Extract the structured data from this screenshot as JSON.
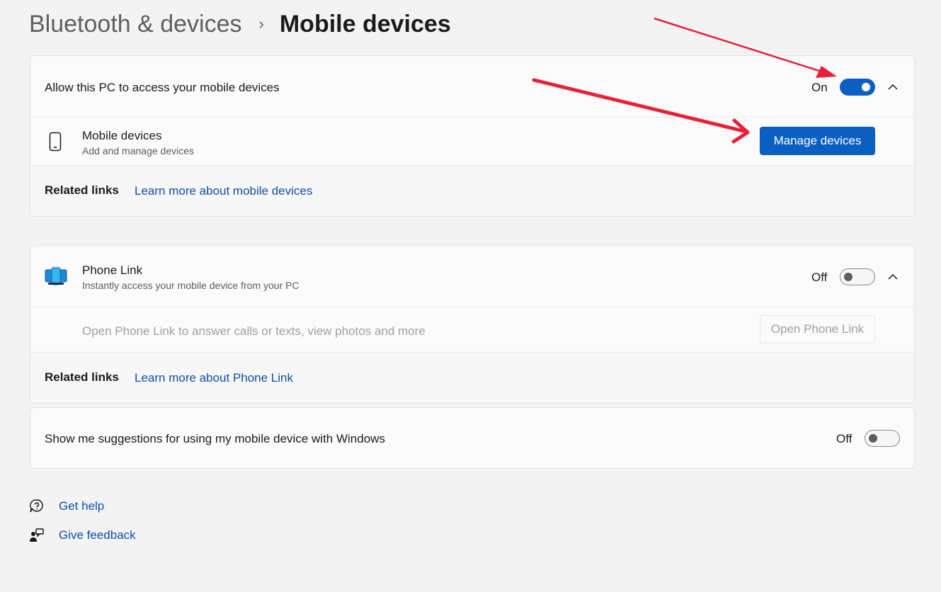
{
  "breadcrumb": {
    "parent": "Bluetooth & devices",
    "separator": "›",
    "current": "Mobile devices"
  },
  "mobile_access": {
    "label": "Allow this PC to access your mobile devices",
    "state_label": "On",
    "enabled": true,
    "device_row": {
      "icon": "phone-icon",
      "title": "Mobile devices",
      "subtitle": "Add and manage devices",
      "button_label": "Manage devices"
    },
    "related": {
      "label": "Related links",
      "link": "Learn more about mobile devices"
    }
  },
  "phone_link": {
    "icon": "phone-link-app-icon",
    "title": "Phone Link",
    "subtitle": "Instantly access your mobile device from your PC",
    "state_label": "Off",
    "enabled": false,
    "open_row": {
      "description": "Open Phone Link to answer calls or texts, view photos and more",
      "button_label": "Open Phone Link"
    },
    "related": {
      "label": "Related links",
      "link": "Learn more about Phone Link"
    }
  },
  "suggestions": {
    "label": "Show me suggestions for using my mobile device with Windows",
    "state_label": "Off",
    "enabled": false
  },
  "footer": {
    "help": {
      "icon": "help-icon",
      "label": "Get help"
    },
    "feedback": {
      "icon": "feedback-icon",
      "label": "Give feedback"
    }
  },
  "colors": {
    "accent": "#0b5fc3",
    "link": "#0f4fa8",
    "annotation_arrow": "#e8203a"
  }
}
